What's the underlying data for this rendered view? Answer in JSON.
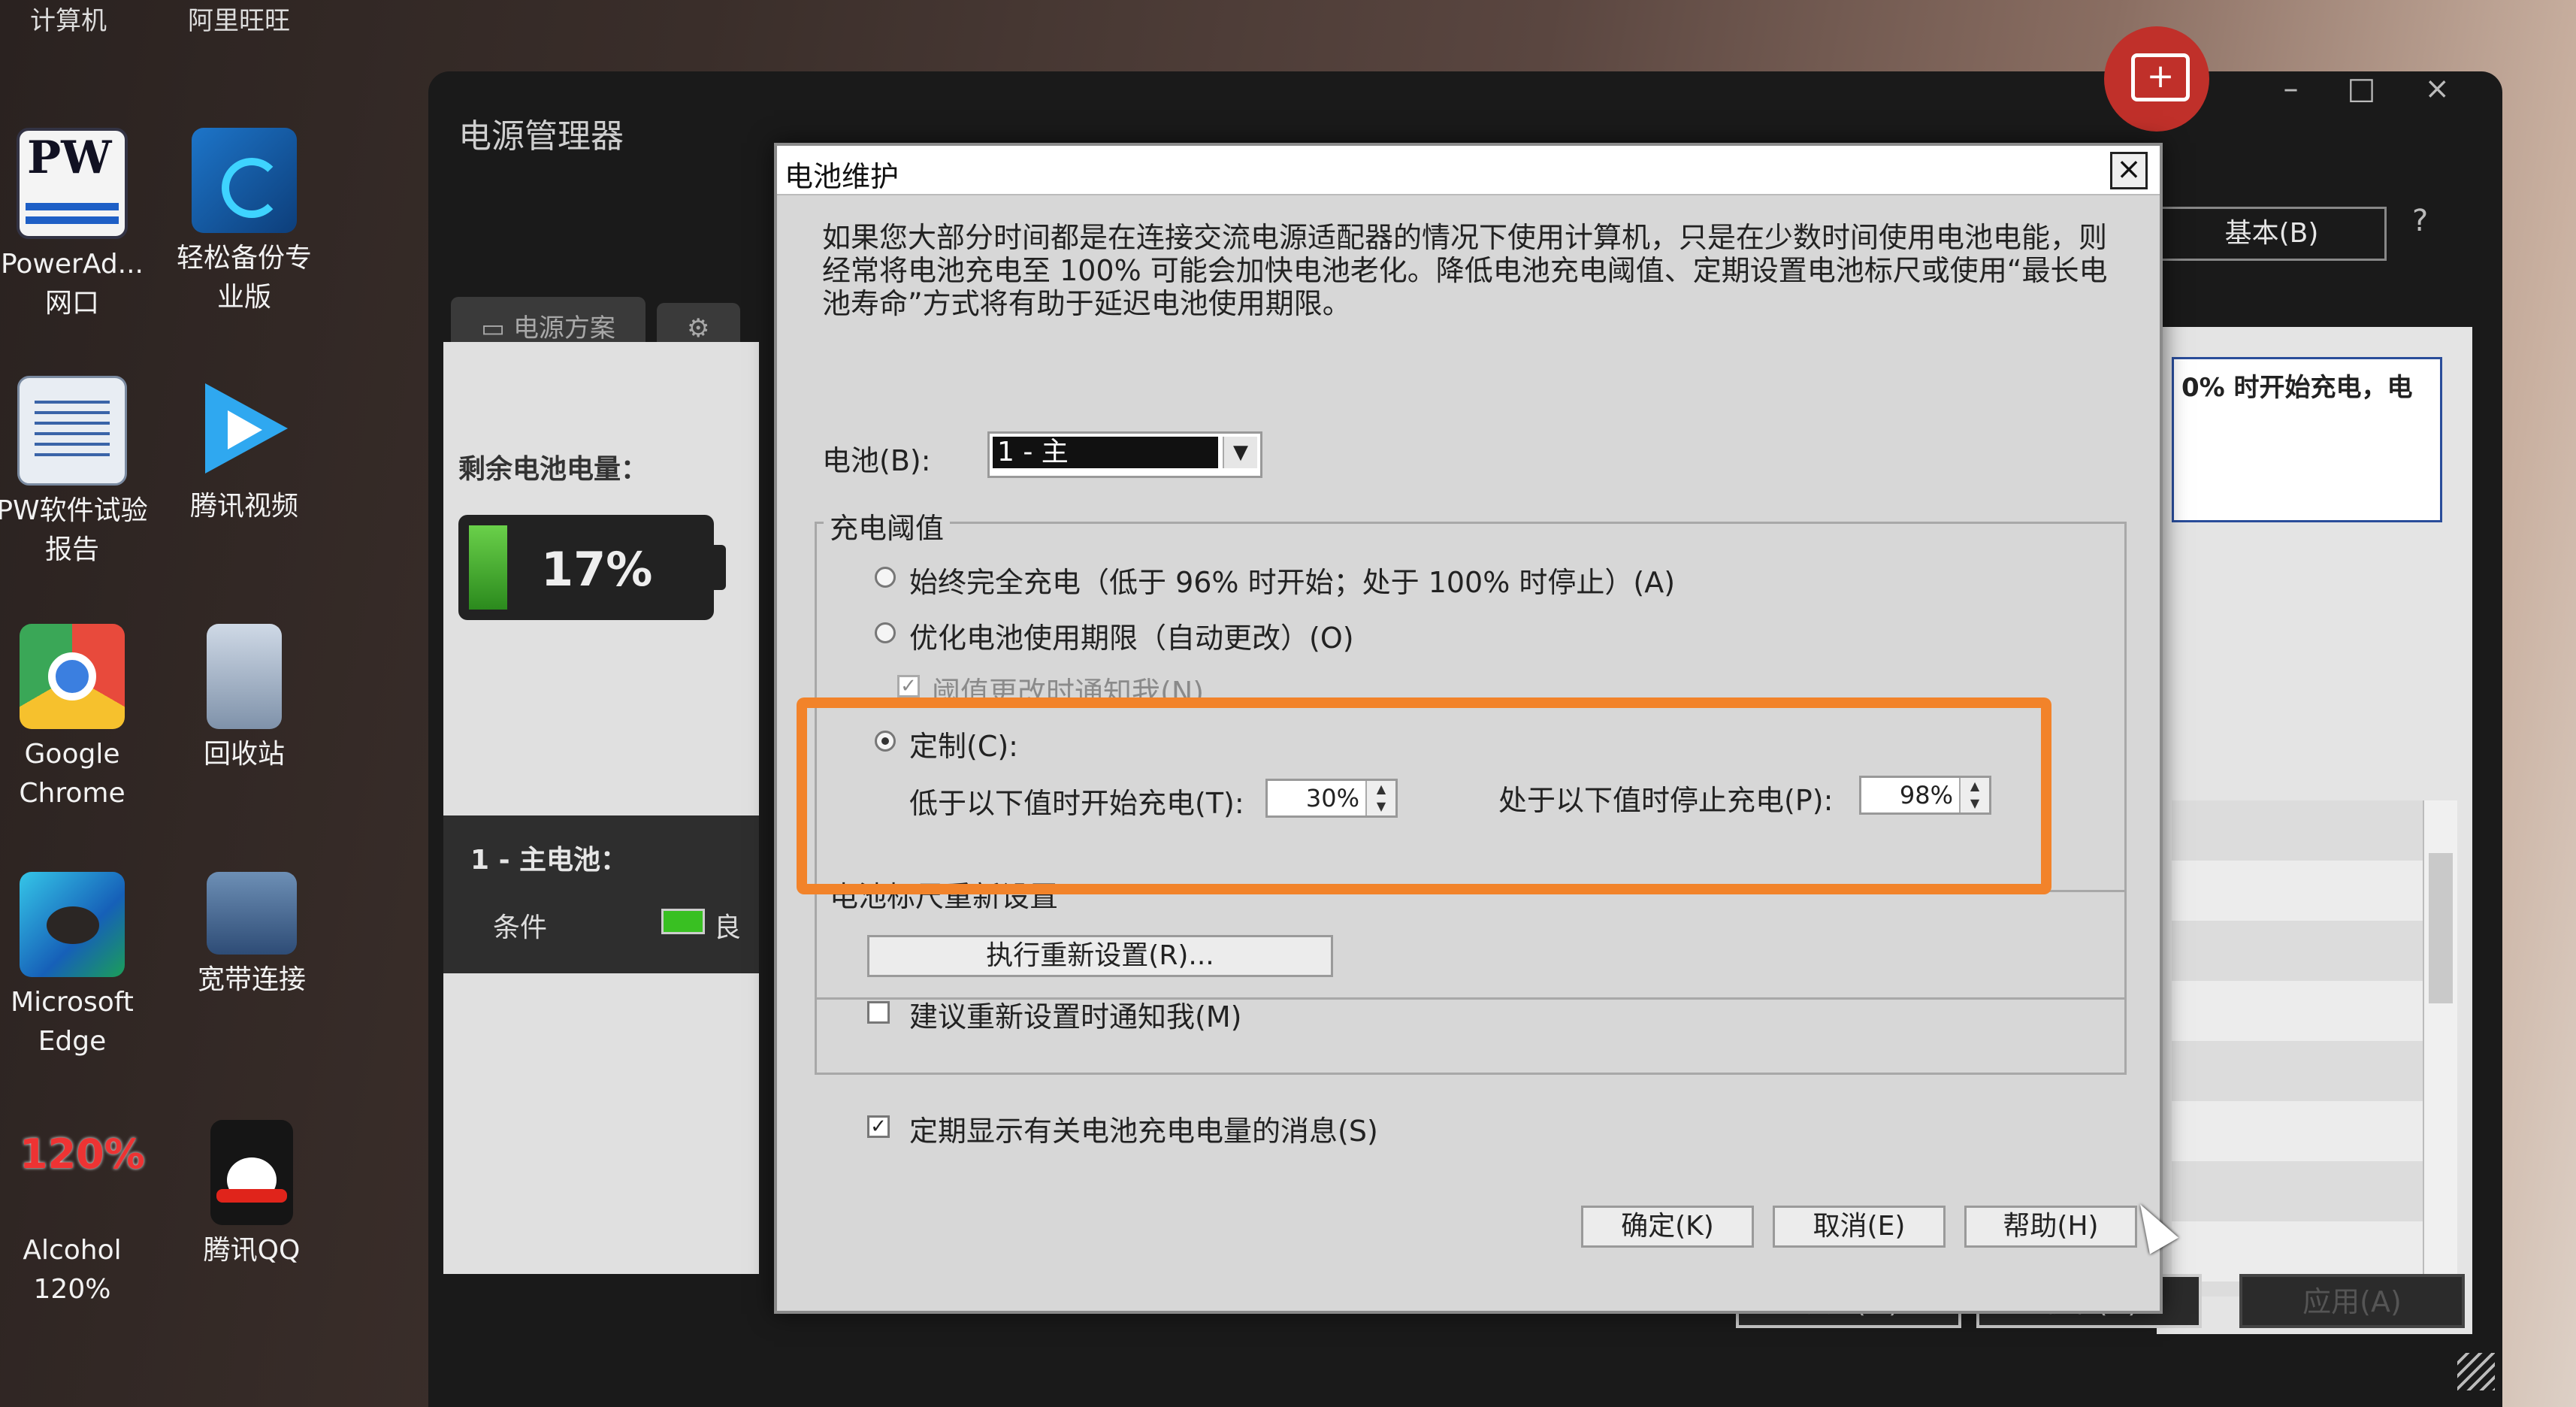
{
  "desktop": {
    "top_labels": [
      "计算机",
      "阿里旺旺"
    ],
    "icons": [
      {
        "label_line1": "PowerAd...",
        "label_line2": "网口",
        "glyph": "PW"
      },
      {
        "label_line1": "轻松备份专",
        "label_line2": "业版"
      },
      {
        "label_line1": "PW软件试验",
        "label_line2": "报告"
      },
      {
        "label_line1": "腾讯视频",
        "label_line2": ""
      },
      {
        "label_line1": "Google",
        "label_line2": "Chrome"
      },
      {
        "label_line1": "回收站",
        "label_line2": ""
      },
      {
        "label_line1": "Microsoft",
        "label_line2": "Edge"
      },
      {
        "label_line1": "宽带连接",
        "label_line2": ""
      },
      {
        "label_line1": "Alcohol",
        "label_line2": "120%",
        "glyph": "120%"
      },
      {
        "label_line1": "腾讯QQ",
        "label_line2": ""
      }
    ]
  },
  "power_manager": {
    "title": "电源管理器",
    "controls": [
      "–",
      "□",
      "×"
    ],
    "tabs": [
      "电源方案",
      ""
    ],
    "remaining_label": "剩余电池电量：",
    "battery_percent_text": "17%",
    "battery_level": 0.17,
    "main_battery_label": "1 - 主电池：",
    "condition_label": "条件",
    "condition_value": "良",
    "basic_button": "基本(B)",
    "help_icon_text": "?",
    "right_panel_text": "0% 时开始充电，电",
    "ok_button": "确定(O)",
    "cancel_button": "取消(C)",
    "apply_button": "应用(A)"
  },
  "dialog": {
    "title": "电池维护",
    "close_glyph": "×",
    "description": "如果您大部分时间都是在连接交流电源适配器的情况下使用计算机，只是在少数时间使用电池电能，则经常将电池充电至 100% 可能会加快电池老化。降低电池充电阈值、定期设置电池标尺或使用“最长电池寿命”方式将有助于延迟电池使用期限。",
    "battery_label": "电池(B):",
    "battery_selected": "1 - 主",
    "threshold_group": "充电阈值",
    "option_always": "始终完全充电（低于 96% 时开始；处于 100% 时停止）(A)",
    "option_optimize": "优化电池使用期限（自动更改）(O)",
    "notify_change": "阈值更改时通知我(N)",
    "option_custom": "定制(C):",
    "start_label": "低于以下值时开始充电(T):",
    "start_value": "30%",
    "stop_label": "处于以下值时停止充电(P):",
    "stop_value": "98%",
    "reset_group": "电池标尺重新设置",
    "reset_button": "执行重新设置(R)...",
    "notify_reset": "建议重新设置时通知我(M)",
    "periodic_message": "定期显示有关电池充电电量的消息(S)",
    "check_mark": "✓",
    "ok_button": "确定(K)",
    "cancel_button": "取消(E)",
    "help_button": "帮助(H)"
  },
  "highlight_color": "#f2832a"
}
